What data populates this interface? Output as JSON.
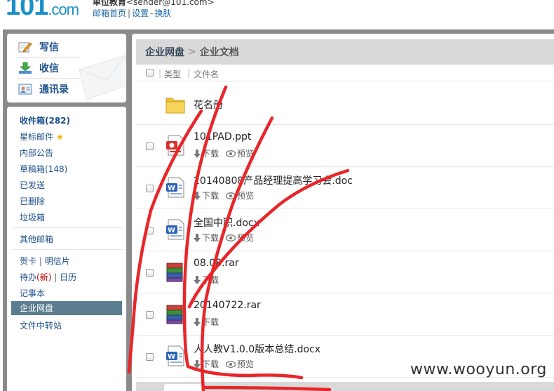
{
  "header": {
    "logo_main": "101",
    "logo_suffix": ".com",
    "user_name": "单位教育",
    "user_email": "<sender@101.com>",
    "links": [
      "邮箱首页",
      "设置",
      "换肤"
    ],
    "link_seps": [
      "|",
      "-"
    ]
  },
  "compose": {
    "items": [
      {
        "label": "写信",
        "icon": "pencil-icon"
      },
      {
        "label": "收信",
        "icon": "download-icon"
      },
      {
        "label": "通讯录",
        "icon": "contacts-icon"
      }
    ]
  },
  "folders": {
    "inbox": "收件箱(282)",
    "starred": "星标邮件",
    "internal": "内部公告",
    "drafts": "草稿箱(148)",
    "sent": "已发送",
    "deleted": "已删除",
    "spam": "垃圾箱",
    "other": "其他邮箱",
    "cards": "贺卡",
    "postcards": "明信片",
    "todo": "待办",
    "todo_new": "(新)",
    "calendar": "日历",
    "notes": "记事本",
    "disk": "企业网盘",
    "transfer": "文件中转站",
    "sep": "|"
  },
  "main": {
    "breadcrumb": {
      "root": "企业网盘",
      "arrow": ">",
      "current": "企业文档"
    },
    "columns": {
      "type": "类型",
      "name": "文件名",
      "sep": "|"
    },
    "actions": {
      "download": "下载",
      "preview": "预览"
    },
    "files": [
      {
        "name": "花名册",
        "type": "folder"
      },
      {
        "name": "101PAD.ppt",
        "type": "ppt"
      },
      {
        "name": "20140808产品经理提高学习会.doc",
        "type": "doc"
      },
      {
        "name": "全国中职.docx",
        "type": "doc"
      },
      {
        "name": "08.08.rar",
        "type": "rar"
      },
      {
        "name": "20140722.rar",
        "type": "rar"
      },
      {
        "name": "人人教V1.0.0版本总结.docx",
        "type": "doc"
      }
    ]
  },
  "watermark": "www.wooyun.org",
  "colors": {
    "logo": "#1a8fc9",
    "link": "#1b4f8a",
    "frame": "#8b8b8b",
    "selected": "#5a7d92",
    "scribble": "#e8262a"
  }
}
